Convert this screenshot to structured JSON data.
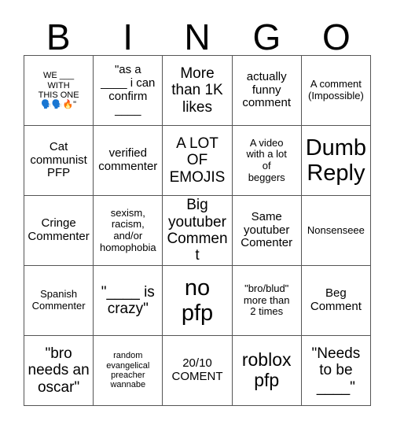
{
  "card": {
    "title_letters": [
      "B",
      "I",
      "N",
      "G",
      "O"
    ],
    "rows": [
      [
        {
          "text": "WE ___\nWITH\nTHIS ONE\n🗣️🗣️🔥\"",
          "size": "fs-xs"
        },
        {
          "text": "\"as a\n____ i can\nconfirm\n____",
          "size": "fs-m"
        },
        {
          "text": "More\nthan 1K\nlikes",
          "size": "fs-l"
        },
        {
          "text": "actually\nfunny\ncomment",
          "size": "fs-m"
        },
        {
          "text": "A comment\n(Impossible)",
          "size": "fs-s"
        }
      ],
      [
        {
          "text": "Cat\ncommunist\nPFP",
          "size": "fs-m"
        },
        {
          "text": "verified\ncommenter",
          "size": "fs-m"
        },
        {
          "text": "A LOT\nOF\nEMOJIS",
          "size": "fs-l"
        },
        {
          "text": "A video\nwith a lot\nof\nbeggers",
          "size": "fs-s"
        },
        {
          "text": "Dumb\nReply",
          "size": "fs-xxl"
        }
      ],
      [
        {
          "text": "Cringe\nCommenter",
          "size": "fs-m"
        },
        {
          "text": "sexism,\nracism,\nand/or\nhomophobia",
          "size": "fs-s"
        },
        {
          "text": "Big\nyoutuber\nComment",
          "size": "fs-l"
        },
        {
          "text": "Same\nyoutuber\nComenter",
          "size": "fs-m"
        },
        {
          "text": "Nonsenseee",
          "size": "fs-s"
        }
      ],
      [
        {
          "text": "Spanish\nCommenter",
          "size": "fs-s"
        },
        {
          "text": "\"____ is\ncrazy\"",
          "size": "fs-l"
        },
        {
          "text": "no\npfp",
          "size": "fs-xxl"
        },
        {
          "text": "\"bro/blud\"\nmore than\n2 times",
          "size": "fs-s"
        },
        {
          "text": "Beg\nComment",
          "size": "fs-m"
        }
      ],
      [
        {
          "text": "\"bro\nneeds an\noscar\"",
          "size": "fs-l"
        },
        {
          "text": "random\nevangelical\npreacher\nwannabe",
          "size": "fs-xs"
        },
        {
          "text": "20/10\nCOMENT",
          "size": "fs-m"
        },
        {
          "text": "roblox\npfp",
          "size": "fs-xl"
        },
        {
          "text": "\"Needs\nto be\n____\"",
          "size": "fs-l"
        }
      ]
    ]
  },
  "colors": {
    "background": "#ffffff",
    "text": "#000000",
    "grid_line": "#555555",
    "emoji_blue": "#1d7fe0",
    "emoji_fire": "#f08020"
  }
}
